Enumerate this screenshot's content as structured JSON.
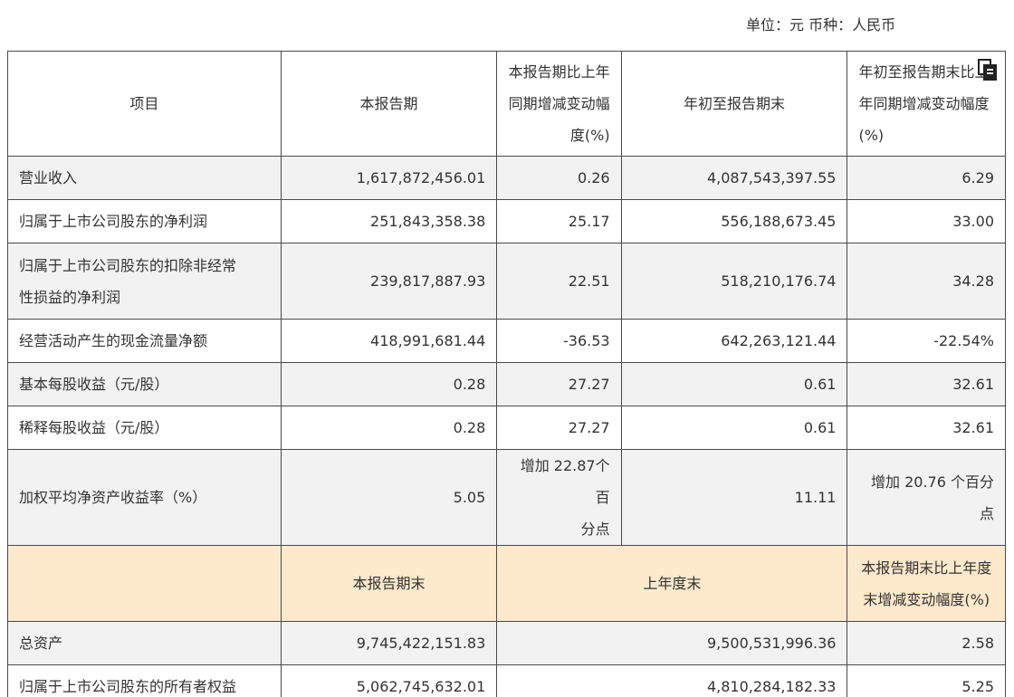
{
  "unit_line": "单位：元  币种：人民币",
  "header": {
    "item": "项目",
    "current_period": "本报告期",
    "current_change": [
      "本报告期比上年",
      "同期增减变动幅",
      "度(%)"
    ],
    "ytd": "年初至报告期末",
    "ytd_change": [
      "年初至报告期末比上",
      "年同期增减变动幅度",
      "(%)"
    ]
  },
  "rows": [
    {
      "name": "营业收入",
      "current": "1,617,872,456.01",
      "current_change": "0.26",
      "ytd": "4,087,543,397.55",
      "ytd_change": "6.29"
    },
    {
      "name": "归属于上市公司股东的净利润",
      "current": "251,843,358.38",
      "current_change": "25.17",
      "ytd": "556,188,673.45",
      "ytd_change": "33.00"
    },
    {
      "name_lines": [
        "归属于上市公司股东的扣除非经常",
        "性损益的净利润"
      ],
      "current": "239,817,887.93",
      "current_change": "22.51",
      "ytd": "518,210,176.74",
      "ytd_change": "34.28"
    },
    {
      "name": "经营活动产生的现金流量净额",
      "current": "418,991,681.44",
      "current_change": "-36.53",
      "ytd": "642,263,121.44",
      "ytd_change": "-22.54%"
    },
    {
      "name": "基本每股收益（元/股）",
      "current": "0.28",
      "current_change": "27.27",
      "ytd": "0.61",
      "ytd_change": "32.61"
    },
    {
      "name": "稀释每股收益（元/股）",
      "current": "0.28",
      "current_change": "27.27",
      "ytd": "0.61",
      "ytd_change": "32.61"
    },
    {
      "name": "加权平均净资产收益率（%）",
      "current": "5.05",
      "current_change_lines": [
        "增加 22.87个百",
        "分点"
      ],
      "ytd": "11.11",
      "ytd_change": "增加 20.76 个百分点"
    }
  ],
  "balance_header": {
    "item": "",
    "period_end": "本报告期末",
    "last_year_end": "上年度末",
    "change": [
      "本报告期末比上年度",
      "末增减变动幅度(%)"
    ]
  },
  "balance_rows": [
    {
      "name": "总资产",
      "period_end": "9,745,422,151.83",
      "last_year_end": "9,500,531,996.36",
      "change": "2.58"
    },
    {
      "name": "归属于上市公司股东的所有者权益",
      "period_end": "5,062,745,632.01",
      "last_year_end": "4,810,284,182.33",
      "change": "5.25"
    }
  ],
  "icons": {
    "copy": "copy-icon"
  }
}
